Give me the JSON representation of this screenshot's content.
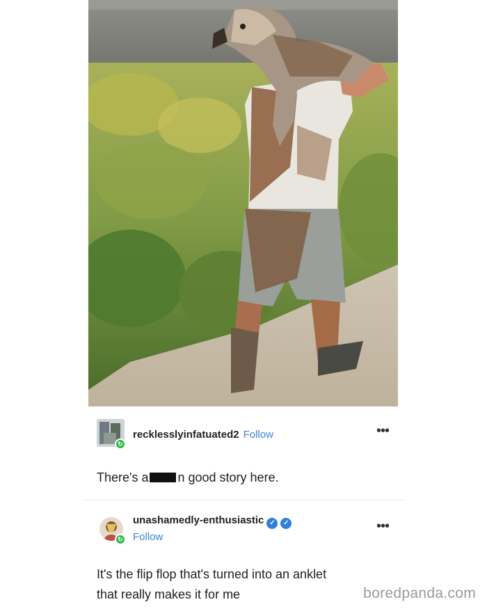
{
  "post1": {
    "username": "recklesslyinfatuated2",
    "follow_label": "Follow",
    "more_label": "•••",
    "text_before": "There's a",
    "text_after": "n good story here."
  },
  "post2": {
    "username": "unashamedly-enthusiastic",
    "follow_label": "Follow",
    "more_label": "•••",
    "text_line1": "It's the flip flop that's turned into an anklet",
    "text_line2": "that really makes it for me"
  },
  "watermark": "boredpanda.com"
}
